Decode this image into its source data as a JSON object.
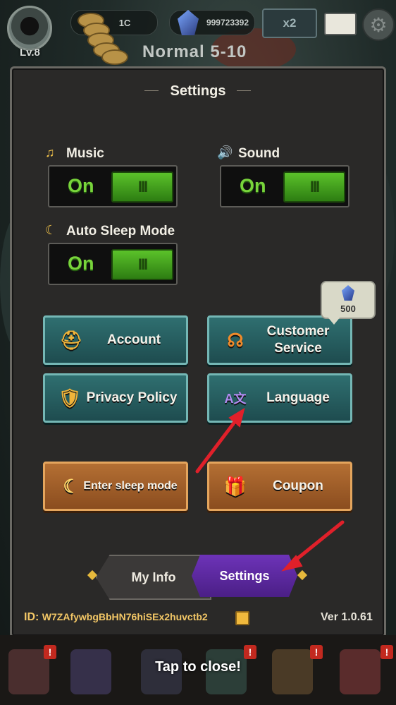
{
  "hud": {
    "level": "Lv.8",
    "coins": "1C",
    "gems": "999723392",
    "multiplier": "x2",
    "stage": "Normal 5-10"
  },
  "dialog": {
    "title": "Settings",
    "music": {
      "label": "Music",
      "state": "On",
      "icon": "music-note-icon"
    },
    "sound": {
      "label": "Sound",
      "state": "On",
      "icon": "speaker-icon"
    },
    "auto_sleep": {
      "label": "Auto Sleep Mode",
      "state": "On",
      "icon": "moon-sparkle-icon"
    },
    "buttons": {
      "account": "Account",
      "customer_service_line1": "Customer",
      "customer_service_line2": "Service",
      "privacy_policy": "Privacy Policy",
      "language": "Language",
      "enter_sleep_mode": "Enter sleep mode",
      "coupon": "Coupon"
    },
    "customer_service_reward": "500",
    "tabs": {
      "my_info": "My Info",
      "settings": "Settings"
    },
    "id_label": "ID:",
    "id_value": "W7ZAfywbgBbHN76hiSEx2huvctb2",
    "version": "Ver 1.0.61"
  },
  "bottom": {
    "tap_to_close": "Tap to close!"
  },
  "colors": {
    "accent_green": "#78d43b",
    "teal_button": "#2f6f70",
    "orange_button": "#b46f33",
    "tab_active": "#6d33b8",
    "arrow": "#e0202a"
  }
}
